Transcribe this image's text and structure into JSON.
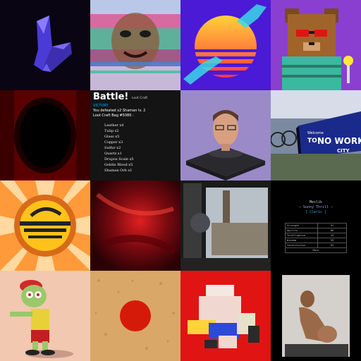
{
  "battle": {
    "title": "Battle!",
    "subtitle": "Loot Craft",
    "status": "VICTORY",
    "defeated": "You defeated x2 Shaman lv. 2",
    "bag": "Loot Craft Bag #5080 :",
    "items": [
      "Leather x4",
      "Tulip x2",
      "Glass x5",
      "Copper x3",
      "Sulfur x2",
      "Quartz x1",
      "Drupox Scale x5",
      "Goblin Blood x5",
      "Shaman Orb x1"
    ]
  },
  "billboard": {
    "line1": "Welcome",
    "line2": "TO",
    "line3": "NO WORK",
    "line4": "CITY"
  },
  "character": {
    "name": "Meslik",
    "epithet": "— Sunny Thrill —",
    "class": "[ Cleric ]",
    "stats": [
      {
        "label": "Strength",
        "value": "91"
      },
      {
        "label": "Agility",
        "value": "86"
      },
      {
        "label": "Intelligence",
        "value": "43"
      },
      {
        "label": "Wisdom",
        "value": "99"
      },
      {
        "label": "Constitution",
        "value": "65"
      }
    ],
    "footer": "Male"
  },
  "colors": {
    "battle_bg": "#141414",
    "victory": "#00aaff",
    "poster_red": "#e11414",
    "sunset_orange": "#ff8a1e",
    "purple_bg": "#8a3fd1"
  },
  "tiles": [
    "purple-crystal-art",
    "glitch-face-art",
    "synthwave-sun-hands-art",
    "pixel-bear-avatar",
    "dark-red-portal-art",
    "battle-loot-card",
    "bust-avatar-3d",
    "no-work-city-comic",
    "retro-sun-badge",
    "red-fabric-art",
    "train-window-photo",
    "character-stats-card",
    "zombie-cartoon",
    "cork-red-dot",
    "pixelated-cat-collage",
    "photo-figure"
  ]
}
